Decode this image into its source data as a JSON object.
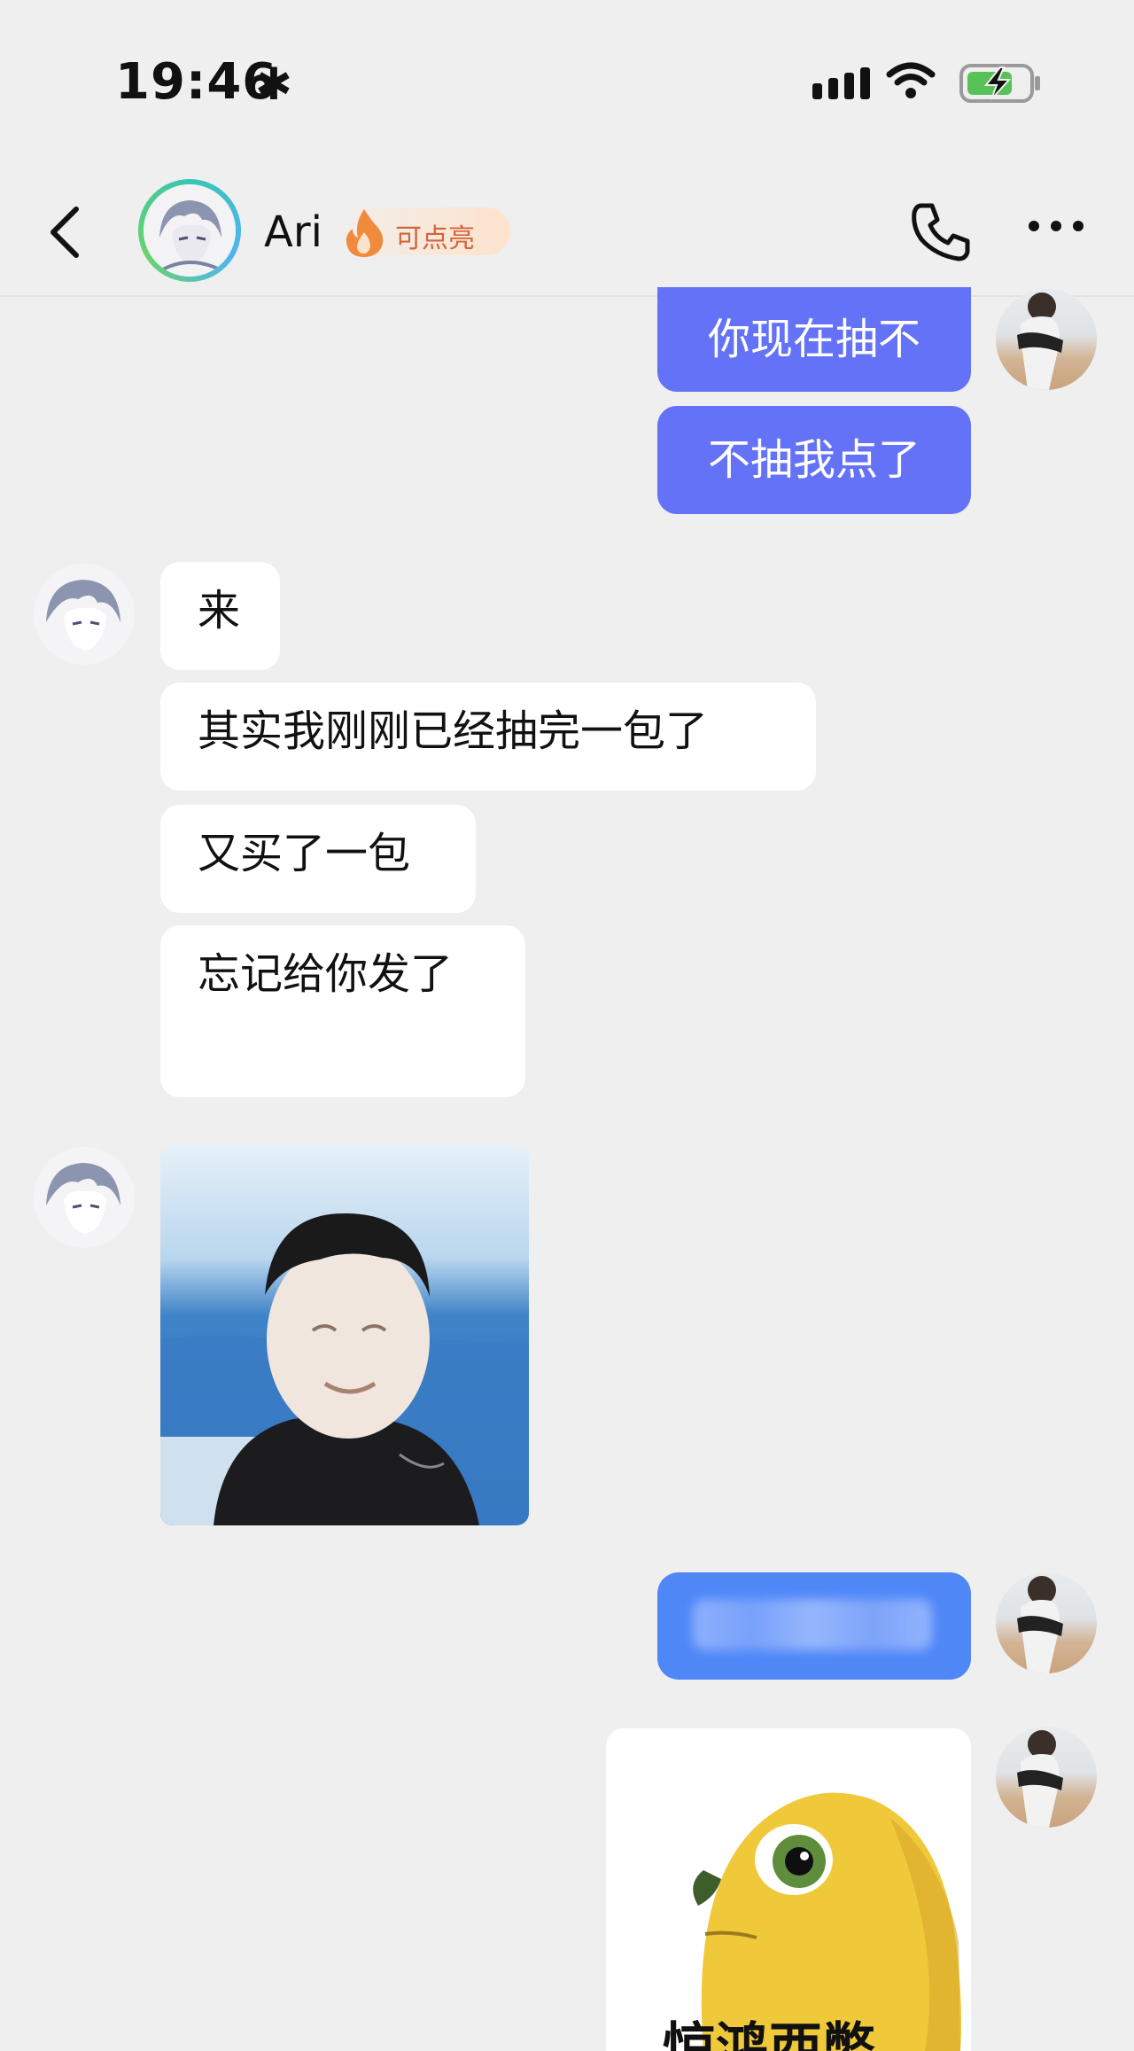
{
  "status_bar": {
    "time": "19:46",
    "time_suffix": "✱"
  },
  "header": {
    "contact_name": "Ari",
    "badge_label": "可点亮"
  },
  "messages": {
    "out_1": "你现在抽不",
    "out_2": "不抽我点了",
    "in_1": "来",
    "in_2": "其实我刚刚已经抽完一包了",
    "in_3": "又买了一包",
    "in_4": "忘记给你发了"
  },
  "stickers": {
    "bird_caption": "惊鸿西嫳"
  },
  "colors": {
    "outgoing_bubble": "#6472f7",
    "blurred_bubble": "#4f87f7",
    "background": "#efefef",
    "badge_text": "#d4643a"
  },
  "icons": [
    "back-icon",
    "phone-icon",
    "more-icon",
    "flame-icon",
    "signal-icon",
    "wifi-icon",
    "battery-icon"
  ]
}
